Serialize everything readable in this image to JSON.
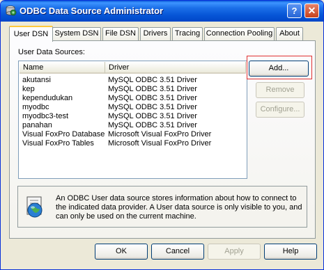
{
  "window": {
    "title": "ODBC Data Source Administrator",
    "help_label": "?",
    "close_label": "✕"
  },
  "tabs": [
    {
      "label": "User DSN"
    },
    {
      "label": "System DSN"
    },
    {
      "label": "File DSN"
    },
    {
      "label": "Drivers"
    },
    {
      "label": "Tracing"
    },
    {
      "label": "Connection Pooling"
    },
    {
      "label": "About"
    }
  ],
  "user_dsn": {
    "section_label": "User Data Sources:",
    "columns": {
      "name": "Name",
      "driver": "Driver"
    },
    "rows": [
      {
        "name": "akutansi",
        "driver": "MySQL ODBC 3.51 Driver"
      },
      {
        "name": "kep",
        "driver": "MySQL ODBC 3.51 Driver"
      },
      {
        "name": "kependudukan",
        "driver": "MySQL ODBC 3.51 Driver"
      },
      {
        "name": "myodbc",
        "driver": "MySQL ODBC 3.51 Driver"
      },
      {
        "name": "myodbc3-test",
        "driver": "MySQL ODBC 3.51 Driver"
      },
      {
        "name": "panahan",
        "driver": "MySQL ODBC 3.51 Driver"
      },
      {
        "name": "Visual FoxPro Database",
        "driver": "Microsoft Visual FoxPro Driver"
      },
      {
        "name": "Visual FoxPro Tables",
        "driver": "Microsoft Visual FoxPro Driver"
      }
    ],
    "buttons": {
      "add": "Add...",
      "remove": "Remove",
      "configure": "Configure..."
    },
    "info_text": "An ODBC User data source stores information about how to connect to the indicated data provider.   A User data source is only visible to you, and can only be used on the current machine."
  },
  "footer": {
    "ok": "OK",
    "cancel": "Cancel",
    "apply": "Apply",
    "help": "Help"
  },
  "colors": {
    "titlebar": "#0055e5",
    "highlight": "#e03030",
    "tab_active_accent": "#ffc83c"
  }
}
